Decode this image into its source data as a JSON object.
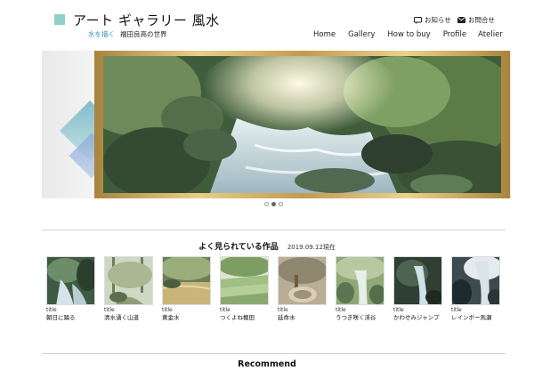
{
  "header": {
    "title": "アート ギャラリー 風水",
    "tagline_accent": "水を描く",
    "tagline_rest": "福田良高の世界",
    "util_news": "お知らせ",
    "util_contact": "お問合せ",
    "nav": [
      "Home",
      "Gallery",
      "How to buy",
      "Profile",
      "Atelier"
    ]
  },
  "carousel": {
    "slides": 3,
    "active": 2
  },
  "popular": {
    "heading": "よく見られている作品",
    "date": "2019.09.12現在",
    "items": [
      {
        "label": "title",
        "name": "朝日に踊る"
      },
      {
        "label": "title",
        "name": "清水湧く山道"
      },
      {
        "label": "title",
        "name": "黄金水"
      },
      {
        "label": "title",
        "name": "つくよね棚田"
      },
      {
        "label": "title",
        "name": "延命水"
      },
      {
        "label": "title",
        "name": "うつぎ咲く渓谷"
      },
      {
        "label": "title",
        "name": "かわせみジャンプ"
      },
      {
        "label": "title",
        "name": "レインボー馬瀬"
      }
    ]
  },
  "recommend": {
    "heading": "Recommend"
  },
  "colors": {
    "accent": "#3a8fb7",
    "logo": "#8fd0c8",
    "frame": "#c29a4f"
  }
}
